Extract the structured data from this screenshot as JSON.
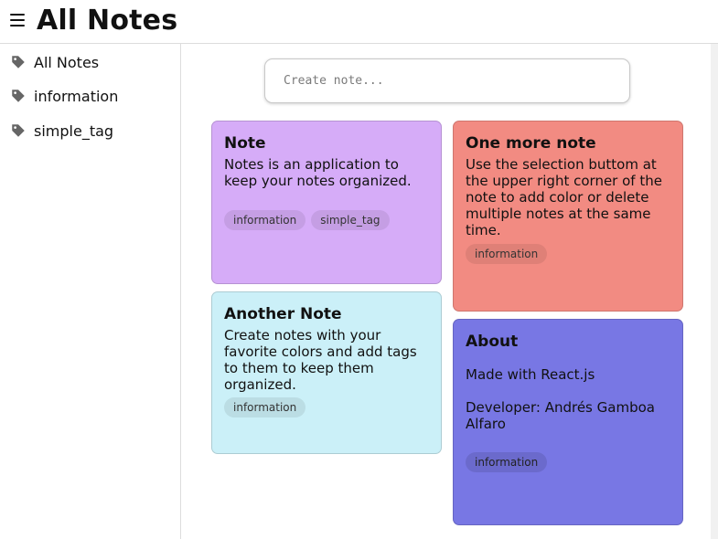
{
  "header": {
    "title": "All Notes",
    "menu_icon": "menu-icon"
  },
  "sidebar": {
    "items": [
      {
        "label": "All Notes",
        "icon": "tag-icon"
      },
      {
        "label": "information",
        "icon": "tag-icon"
      },
      {
        "label": "simple_tag",
        "icon": "tag-icon"
      }
    ]
  },
  "create": {
    "placeholder": "Create note..."
  },
  "notes": [
    {
      "title": "Note",
      "body": "Notes is an application to keep your notes organized.",
      "color": "#d6acf8",
      "tags": [
        "information",
        "simple_tag"
      ]
    },
    {
      "title": "One more note",
      "body": "Use the selection buttom at the upper right corner of the note to add color or delete multiple notes at the same time.",
      "color": "#f28b82",
      "tags": [
        "information"
      ]
    },
    {
      "title": "Another Note",
      "body": "Create notes with your favorite colors and add tags to them to keep them organized.",
      "color": "#cbf0f8",
      "tags": [
        "information"
      ]
    },
    {
      "title": "About",
      "line1": "Made with React.js",
      "line2": "Developer: Andrés Gamboa Alfaro",
      "color": "#7877e4",
      "tags": [
        "information"
      ]
    }
  ]
}
